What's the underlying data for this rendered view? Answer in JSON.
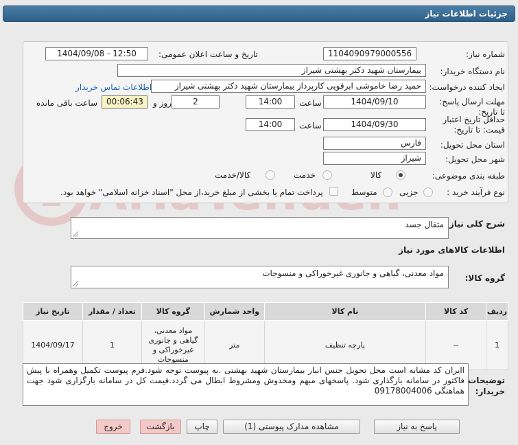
{
  "page_title": "جزئیات اطلاعات نیاز",
  "fields": {
    "need_number_label": "شماره نیاز:",
    "need_number": "1104090979000556",
    "announce_label": "تاریخ و ساعت اعلان عمومی:",
    "announce_value": "1404/09/08 - 12:50",
    "buyer_org_label": "نام دستگاه خریدار:",
    "buyer_org": "بیمارستان شهید دکتر بهشتی شیراز",
    "requester_label": "ایجاد کننده درخواست:",
    "requester": "حمید رضا خاموشی ابرقویی کارپرداز بیمارستان شهید دکتر بهشتی شیراز",
    "contact_link": "اطلاعات تماس خریدار",
    "reply_deadline_label": "مهلت ارسال پاسخ: تا تاریخ:",
    "reply_date": "1404/09/10",
    "time_label": "ساعت",
    "reply_time": "14:00",
    "days_value": "2",
    "days_label": "روز و",
    "remaining_timer": "00:06:43",
    "remaining_label": "ساعت باقی مانده",
    "validity_label": "حداقل تاریخ اعتبار قیمت: تا تاریخ:",
    "validity_date": "1404/09/30",
    "validity_time": "14:00",
    "province_label": "استان محل تحویل:",
    "province": "فارس",
    "city_label": "شهر محل تحویل:",
    "city": "شیراز",
    "category_label": "طبقه بندی موضوعی:",
    "category_options": [
      "کالا",
      "خدمت",
      "کالا/خدمت"
    ],
    "process_label": "نوع فرآیند خرید :",
    "process_options": [
      "جزیی",
      "متوسط"
    ],
    "payment_note": "پرداخت تمام یا بخشی از مبلغ خرید،از محل \"اسناد خزانه اسلامی\" خواهد بود."
  },
  "description": {
    "label": "شرح کلی نیاز:",
    "value": "متقال جسد"
  },
  "goods_section_title": "اطلاعات کالاهای مورد نیاز",
  "goods_group": {
    "label": "گروه کالا:",
    "value": "مواد معدنی، گیاهی و جانوری غیرخوراکی و منسوجات"
  },
  "table": {
    "headers": [
      "ردیف",
      "کد کالا",
      "نام کالا",
      "واحد شمارش",
      "گروه کالا",
      "تعداد / مقدار",
      "تاریخ نیاز"
    ],
    "rows": [
      [
        "1",
        "--",
        "پارچه تنظیف",
        "متر",
        "مواد معدنی، گیاهی و جانوری غیرخوراکی و منسوجات",
        "1",
        "1404/09/17"
      ]
    ]
  },
  "buyer_notes": {
    "label": "توضیحات خریدار:",
    "value": "اایران کد مشابه است محل تحویل جنس انبار بیمارستان شهید بهشتی .به پیوست توجه شود.فرم پیوست تکمیل وهمراه با پیش فاکتور در سامانه بارگذاری شود. پاسخهای مبهم ومخدوش ومشروط ابطال می گردد.قیمت کل در سامانه بارگزاری شود جهت هماهنگی 09178004006"
  },
  "buttons": {
    "reply": "پاسخ به نیاز",
    "attachments": "مشاهده مدارک پیوستی (1)",
    "print": "چاپ",
    "back": "بازگشت",
    "exit": "خروج"
  },
  "watermark_text": "AriaTender.net"
}
